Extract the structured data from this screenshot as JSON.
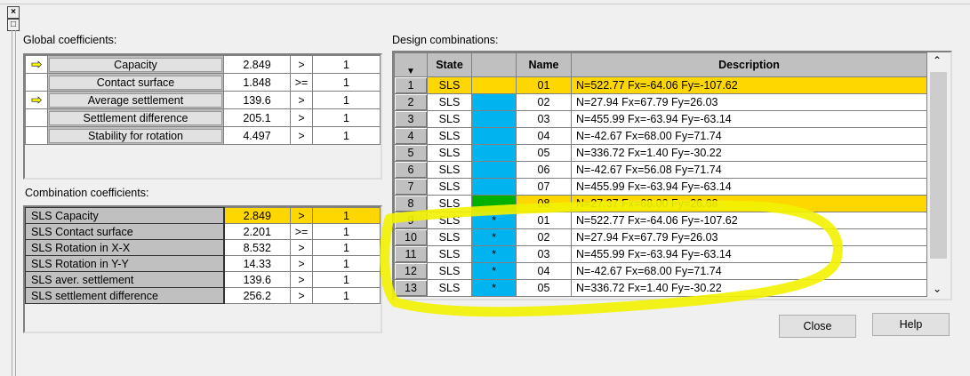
{
  "window": {
    "close_glyph": "×",
    "restore_glyph": "□"
  },
  "global": {
    "title": "Global coefficients:",
    "rows": [
      {
        "arrow": true,
        "name": "Capacity",
        "value": "2.849",
        "op": ">",
        "limit": "1"
      },
      {
        "arrow": false,
        "name": "Contact surface",
        "value": "1.848",
        "op": ">=",
        "limit": "1"
      },
      {
        "arrow": true,
        "name": "Average settlement",
        "value": "139.6",
        "op": ">",
        "limit": "1"
      },
      {
        "arrow": false,
        "name": "Settlement difference",
        "value": "205.1",
        "op": ">",
        "limit": "1"
      },
      {
        "arrow": false,
        "name": "Stability for rotation",
        "value": "4.497",
        "op": ">",
        "limit": "1"
      }
    ]
  },
  "combination": {
    "title": "Combination coefficients:",
    "rows": [
      {
        "name": "SLS Capacity",
        "value": "2.849",
        "op": ">",
        "limit": "1",
        "selected": true
      },
      {
        "name": "SLS Contact surface",
        "value": "2.201",
        "op": ">=",
        "limit": "1"
      },
      {
        "name": "SLS Rotation in X-X",
        "value": "8.532",
        "op": ">",
        "limit": "1"
      },
      {
        "name": "SLS Rotation in Y-Y",
        "value": "14.33",
        "op": ">",
        "limit": "1"
      },
      {
        "name": "SLS aver. settlement",
        "value": "139.6",
        "op": ">",
        "limit": "1"
      },
      {
        "name": "SLS settlement difference",
        "value": "256.2",
        "op": ">",
        "limit": "1"
      }
    ]
  },
  "design": {
    "title": "Design combinations:",
    "headers": {
      "sort": "▼",
      "state": "State",
      "color": "",
      "name": "Name",
      "description": "Description"
    },
    "rows": [
      {
        "n": "1",
        "state": "SLS",
        "color": "none",
        "mark": "",
        "name": "01",
        "desc": "N=522.77 Fx=-64.06 Fy=-107.62",
        "selected": true
      },
      {
        "n": "2",
        "state": "SLS",
        "color": "#00b4f0",
        "mark": "",
        "name": "02",
        "desc": "N=27.94 Fx=67.79 Fy=26.03"
      },
      {
        "n": "3",
        "state": "SLS",
        "color": "#00b4f0",
        "mark": "",
        "name": "03",
        "desc": "N=455.99 Fx=-63.94 Fy=-63.14"
      },
      {
        "n": "4",
        "state": "SLS",
        "color": "#00b4f0",
        "mark": "",
        "name": "04",
        "desc": "N=-42.67 Fx=68.00 Fy=71.74"
      },
      {
        "n": "5",
        "state": "SLS",
        "color": "#00b4f0",
        "mark": "",
        "name": "05",
        "desc": "N=336.72 Fx=1.40 Fy=-30.22"
      },
      {
        "n": "6",
        "state": "SLS",
        "color": "#00b4f0",
        "mark": "",
        "name": "06",
        "desc": "N=-42.67 Fx=56.08 Fy=71.74"
      },
      {
        "n": "7",
        "state": "SLS",
        "color": "#00b4f0",
        "mark": "",
        "name": "07",
        "desc": "N=455.99 Fx=-63.94 Fy=-63.14"
      },
      {
        "n": "8",
        "state": "SLS",
        "color": "#00b000",
        "mark": "",
        "name": "08",
        "desc": "N=27.37 Fx=68.00 Fy=26.68",
        "namehl": true
      },
      {
        "n": "9",
        "state": "SLS",
        "color": "#00b4f0",
        "mark": "*",
        "name": "01",
        "desc": "N=522.77 Fx=-64.06 Fy=-107.62"
      },
      {
        "n": "10",
        "state": "SLS",
        "color": "#00b4f0",
        "mark": "*",
        "name": "02",
        "desc": "N=27.94 Fx=67.79 Fy=26.03"
      },
      {
        "n": "11",
        "state": "SLS",
        "color": "#00b4f0",
        "mark": "*",
        "name": "03",
        "desc": "N=455.99 Fx=-63.94 Fy=-63.14"
      },
      {
        "n": "12",
        "state": "SLS",
        "color": "#00b4f0",
        "mark": "*",
        "name": "04",
        "desc": "N=-42.67 Fx=68.00 Fy=71.74"
      },
      {
        "n": "13",
        "state": "SLS",
        "color": "#00b4f0",
        "mark": "*",
        "name": "05",
        "desc": "N=336.72 Fx=1.40 Fy=-30.22"
      }
    ]
  },
  "buttons": {
    "close": "Close",
    "help": "Help"
  },
  "colors": {
    "highlight": "#ffd700",
    "annotation": "#f5f500"
  }
}
